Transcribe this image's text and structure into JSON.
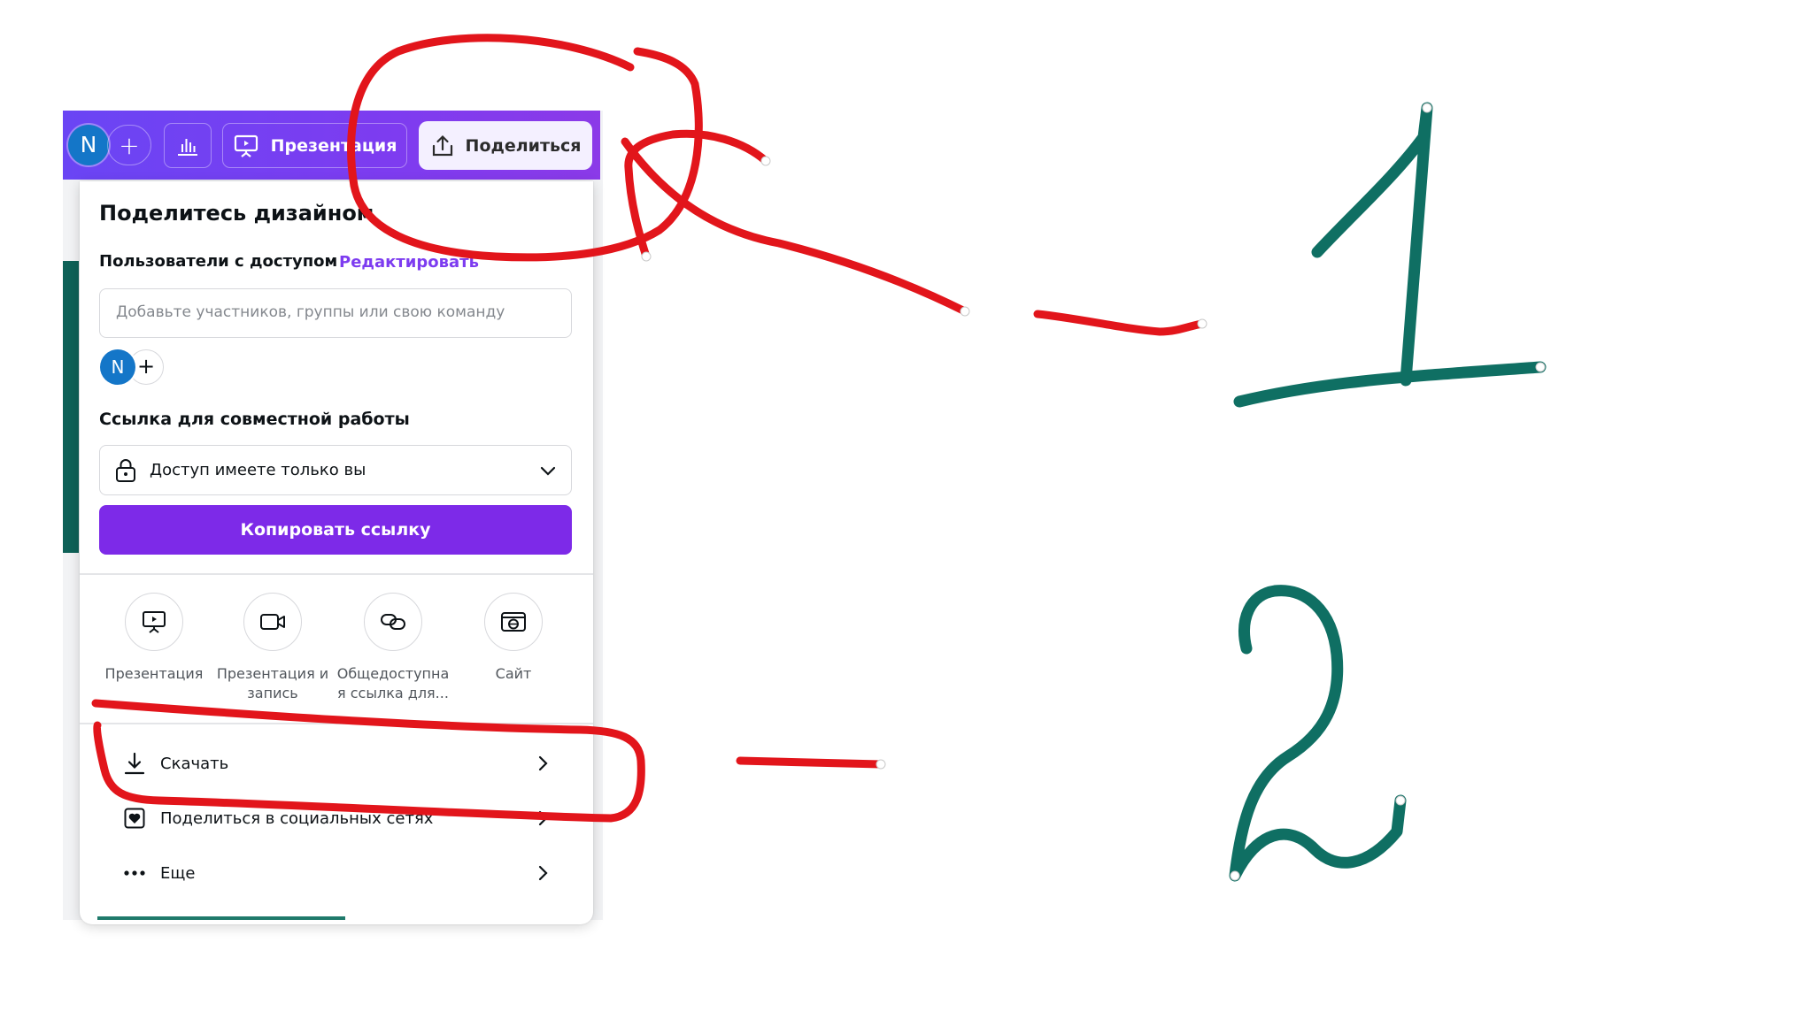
{
  "toolbar": {
    "avatar_initial": "N",
    "add_symbol": "+",
    "present_label": "Презентация",
    "share_label": "Поделиться"
  },
  "share_panel": {
    "title": "Поделитесь дизайном",
    "access_label": "Пользователи с доступом",
    "edit_link": "Редактировать",
    "invite_placeholder": "Добавьте участников, группы или свою команду",
    "member_initial": "N",
    "add_member_symbol": "+",
    "collab_link_label": "Ссылка для совместной работы",
    "access_select_value": "Доступ имеете только вы",
    "copy_link_button": "Копировать ссылку",
    "options": [
      {
        "label_line1": "Презентация",
        "label_line2": "",
        "icon": "presentation-icon"
      },
      {
        "label_line1": "Презентация и",
        "label_line2": "запись",
        "icon": "video-record-icon"
      },
      {
        "label_line1": "Общедоступна",
        "label_line2": "я ссылка для...",
        "icon": "link-icon"
      },
      {
        "label_line1": "Сайт",
        "label_line2": "",
        "icon": "website-icon"
      }
    ],
    "rows": [
      {
        "label": "Скачать",
        "icon": "download-icon"
      },
      {
        "label": "Поделиться в социальных сетях",
        "icon": "heart-square-icon"
      },
      {
        "label": "Еще",
        "icon": "more-dots-icon"
      }
    ]
  },
  "annotations": {
    "red_ink_color": "#e2151b",
    "green_ink_color": "#0f6f63",
    "marker_1": "1",
    "marker_2": "2"
  }
}
